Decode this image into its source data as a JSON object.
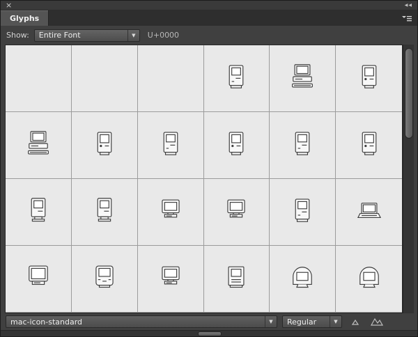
{
  "panel": {
    "title": "Glyphs"
  },
  "icons": {
    "close": "×",
    "collapse": "◀◀",
    "dropdown_arrow": "▼"
  },
  "toolbar": {
    "show_label": "Show:",
    "show_value": "Entire Font",
    "unicode_readout": "U+0000"
  },
  "grid": {
    "columns": 6,
    "rows": 4,
    "cells": [
      [
        "",
        "",
        "",
        "classic",
        "desktop",
        "classic2"
      ],
      [
        "desktop",
        "classic2",
        "classic",
        "classic2",
        "classic",
        "classic2"
      ],
      [
        "compact-stand",
        "compact-stand",
        "monitor",
        "monitor",
        "classic",
        "laptop"
      ],
      [
        "crt",
        "allinone",
        "monitor",
        "cube",
        "imac",
        "imac"
      ]
    ]
  },
  "footer": {
    "font_name": "mac-icon-standard",
    "style_name": "Regular"
  },
  "colors": {
    "panel_bg": "#404040",
    "tab_bg": "#545454",
    "grid_bg": "#e9e9e9",
    "grid_line": "#9b9b9b"
  }
}
